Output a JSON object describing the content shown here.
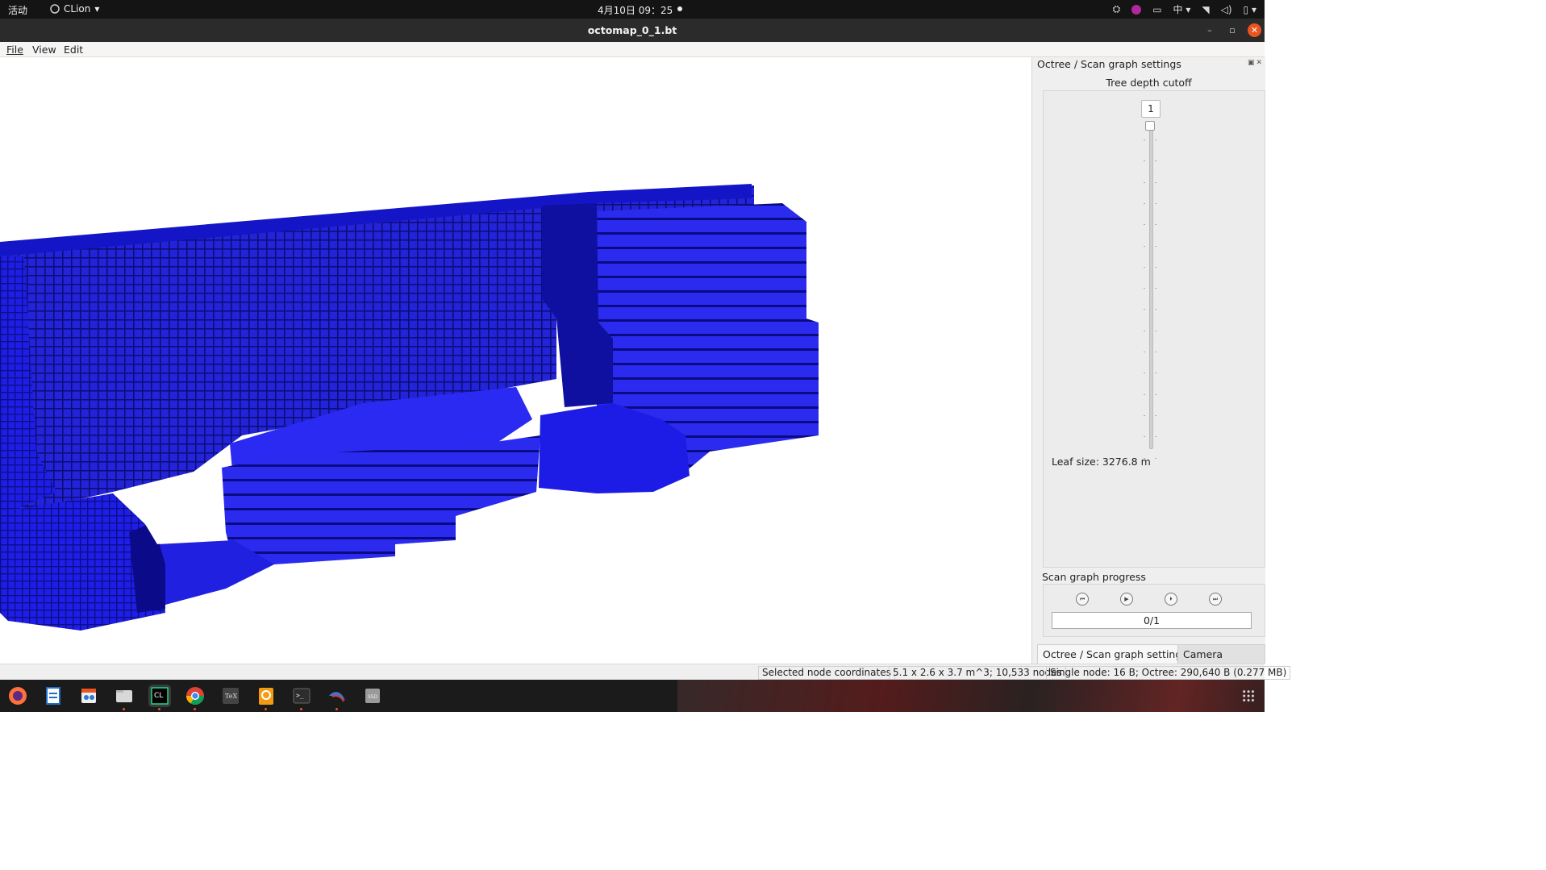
{
  "topbar": {
    "activities": "活动",
    "app_name": "CLion",
    "clock": "4月10日  09：25",
    "input_method": "中"
  },
  "window": {
    "title": "octomap_0_1.bt"
  },
  "menu": {
    "file": "File",
    "view": "View",
    "edit": "Edit"
  },
  "dock_panel": {
    "title": "Octree / Scan graph settings",
    "depth_label": "Tree depth cutoff",
    "depth_value": "1",
    "leaf_size": "Leaf size:  3276.8 m",
    "progress_label": "Scan graph progress",
    "progress_text": "0/1",
    "progress_value": 0,
    "tabs": [
      {
        "label": "Octree / Scan graph settings"
      },
      {
        "label": "Camera settings"
      }
    ]
  },
  "status": {
    "selected": "Selected node coordinates",
    "volume": "5.1 x 2.6 x 3.7 m^3; 10,533 nodes",
    "memory": "Single node: 16 B; Octree: 290,640 B (0.277 MB)"
  },
  "colors": {
    "voxel_main": "#1c1ce6",
    "voxel_dark": "#0b0b8a",
    "accent": "#e95420"
  },
  "taskbar_apps": [
    {
      "icon": "firefox-icon"
    },
    {
      "icon": "writer-icon"
    },
    {
      "icon": "software-icon"
    },
    {
      "icon": "files-icon"
    },
    {
      "icon": "clion-icon"
    },
    {
      "icon": "chrome-icon"
    },
    {
      "icon": "texmaker-icon"
    },
    {
      "icon": "pdf-icon"
    },
    {
      "icon": "terminal-icon"
    },
    {
      "icon": "dragon-icon"
    },
    {
      "icon": "ssd-icon"
    }
  ]
}
